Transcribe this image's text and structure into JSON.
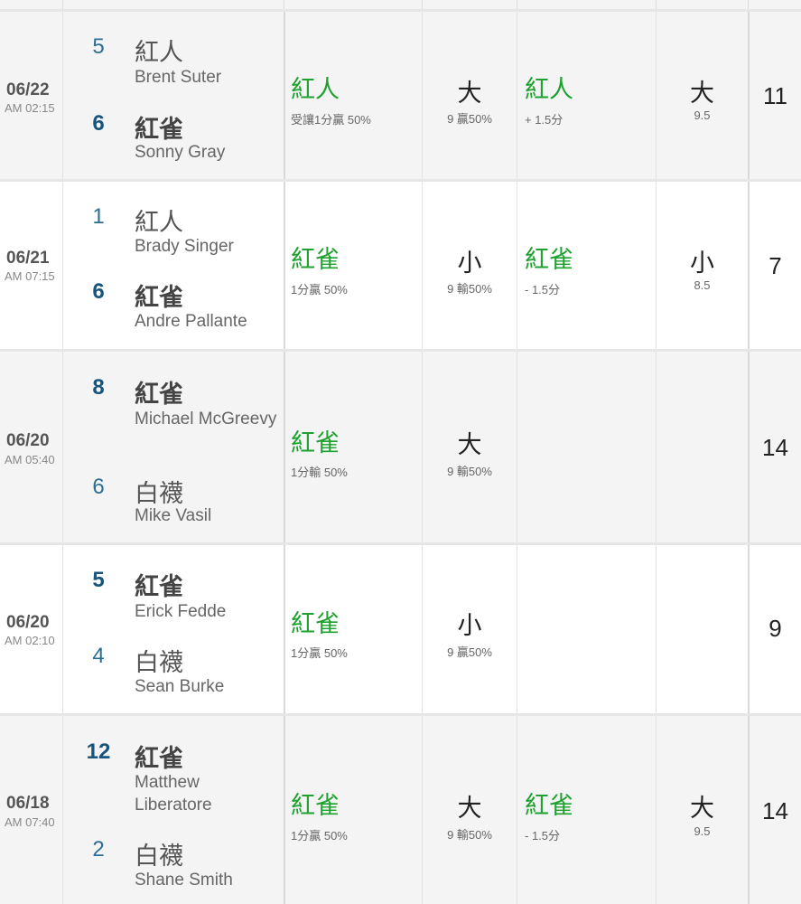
{
  "games": [
    {
      "date": "06/22",
      "time": "AM 02:15",
      "team1": {
        "score": "5",
        "name": "紅人",
        "pitcher": "Brent Suter",
        "win": false
      },
      "team2": {
        "score": "6",
        "name": "紅雀",
        "pitcher": "Sonny Gray",
        "win": true
      },
      "result": {
        "pick": "紅人",
        "note": "受讓1分贏 50%"
      },
      "over_under": {
        "pick": "大",
        "note": "9 贏50%"
      },
      "run_line": {
        "pick": "紅人",
        "note": "+ 1.5分"
      },
      "over_under_2": {
        "pick": "大",
        "note": "9.5"
      },
      "total": "11"
    },
    {
      "date": "06/21",
      "time": "AM 07:15",
      "team1": {
        "score": "1",
        "name": "紅人",
        "pitcher": "Brady Singer",
        "win": false
      },
      "team2": {
        "score": "6",
        "name": "紅雀",
        "pitcher": "Andre Pallante",
        "win": true
      },
      "result": {
        "pick": "紅雀",
        "note": "1分贏 50%"
      },
      "over_under": {
        "pick": "小",
        "note": "9 輸50%"
      },
      "run_line": {
        "pick": "紅雀",
        "note": "- 1.5分"
      },
      "over_under_2": {
        "pick": "小",
        "note": "8.5"
      },
      "total": "7"
    },
    {
      "date": "06/20",
      "time": "AM 05:40",
      "team1": {
        "score": "8",
        "name": "紅雀",
        "pitcher": "Michael McGreevy",
        "win": true
      },
      "team2": {
        "score": "6",
        "name": "白襪",
        "pitcher": "Mike Vasil",
        "win": false
      },
      "result": {
        "pick": "紅雀",
        "note": "1分輸 50%"
      },
      "over_under": {
        "pick": "大",
        "note": "9 輸50%"
      },
      "run_line": {
        "pick": "",
        "note": ""
      },
      "over_under_2": {
        "pick": "",
        "note": ""
      },
      "total": "14"
    },
    {
      "date": "06/20",
      "time": "AM 02:10",
      "team1": {
        "score": "5",
        "name": "紅雀",
        "pitcher": "Erick Fedde",
        "win": true
      },
      "team2": {
        "score": "4",
        "name": "白襪",
        "pitcher": "Sean Burke",
        "win": false
      },
      "result": {
        "pick": "紅雀",
        "note": "1分贏 50%"
      },
      "over_under": {
        "pick": "小",
        "note": "9 贏50%"
      },
      "run_line": {
        "pick": "",
        "note": ""
      },
      "over_under_2": {
        "pick": "",
        "note": ""
      },
      "total": "9"
    },
    {
      "date": "06/18",
      "time": "AM 07:40",
      "team1": {
        "score": "12",
        "name": "紅雀",
        "pitcher": "Matthew Liberatore",
        "win": true
      },
      "team2": {
        "score": "2",
        "name": "白襪",
        "pitcher": "Shane Smith",
        "win": false
      },
      "result": {
        "pick": "紅雀",
        "note": "1分贏 50%"
      },
      "over_under": {
        "pick": "大",
        "note": "9 輸50%"
      },
      "run_line": {
        "pick": "紅雀",
        "note": "- 1.5分"
      },
      "over_under_2": {
        "pick": "大",
        "note": "9.5"
      },
      "total": "14"
    }
  ]
}
